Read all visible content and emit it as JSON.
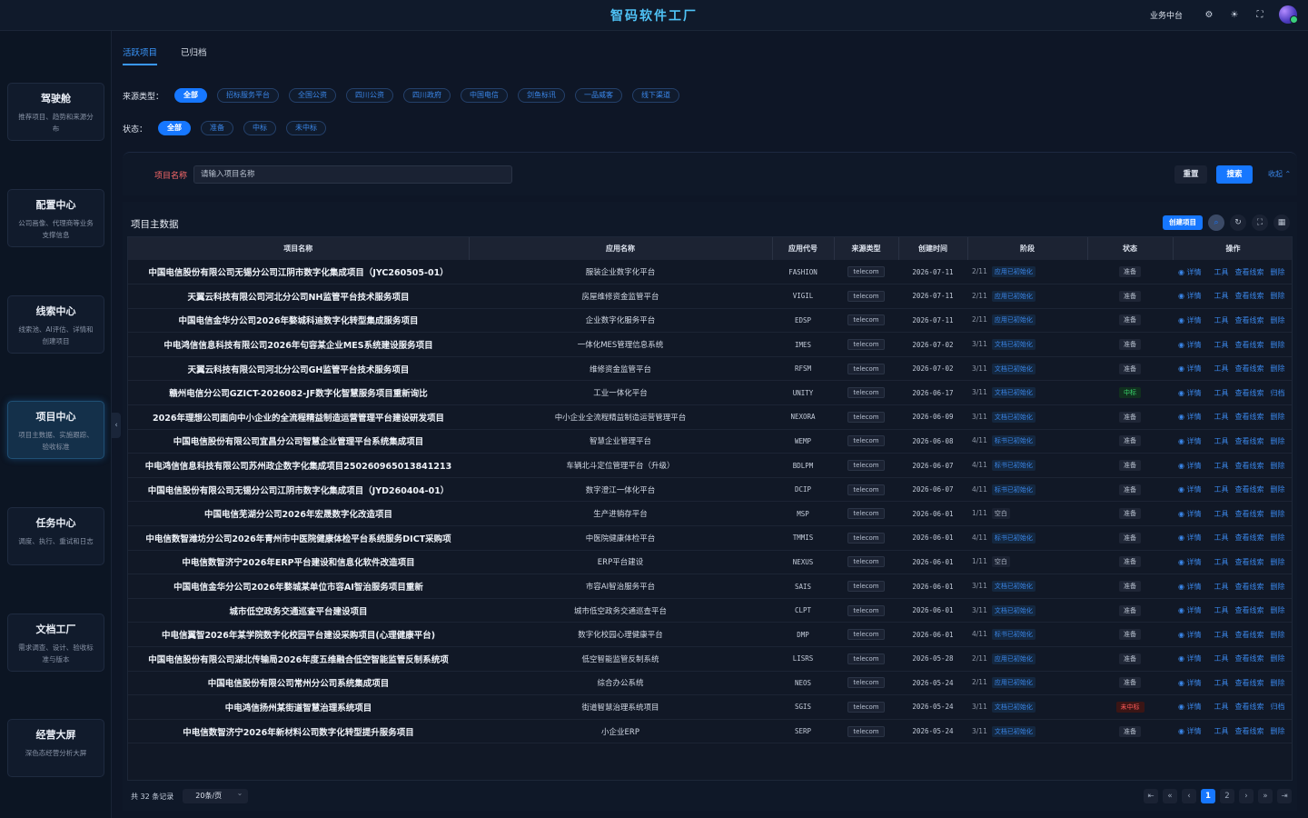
{
  "header": {
    "title": "智码软件工厂",
    "business_link": "业务中台",
    "icons": [
      "gear-icon",
      "sun-icon",
      "fullscreen-icon",
      "avatar"
    ]
  },
  "sidebar": {
    "items": [
      {
        "title": "驾驶舱",
        "desc": "推荐项目、趋势和来源分布"
      },
      {
        "title": "配置中心",
        "desc": "公司画像、代理商等业务支撑信息"
      },
      {
        "title": "线索中心",
        "desc": "线索池、AI评估、详情和创建项目"
      },
      {
        "title": "项目中心",
        "desc": "项目主数据、实施跟踪、验收标准"
      },
      {
        "title": "任务中心",
        "desc": "调度、执行、重试和日志"
      },
      {
        "title": "文档工厂",
        "desc": "需求调查、设计、验收标准与版本"
      },
      {
        "title": "经营大屏",
        "desc": "深色态经营分析大屏"
      }
    ],
    "active_index": 3
  },
  "tabs": [
    {
      "label": "活跃项目",
      "active": true
    },
    {
      "label": "已归档",
      "active": false
    }
  ],
  "filters": {
    "source_label": "来源类型：",
    "source_options": [
      "全部",
      "招标服务平台",
      "全国公资",
      "四川公资",
      "四川政府",
      "中国电信",
      "剑鱼标讯",
      "一品威客",
      "线下渠道"
    ],
    "status_label": "状态：",
    "status_options": [
      "全部",
      "准备",
      "中标",
      "未中标"
    ]
  },
  "search": {
    "label": "项目名称",
    "placeholder": "请输入项目名称",
    "reset": "重置",
    "submit": "搜索",
    "collapse": "收起 ⌃"
  },
  "table": {
    "title": "项目主数据",
    "create_button": "创建项目",
    "columns": [
      "项目名称",
      "应用名称",
      "应用代号",
      "来源类型",
      "创建时间",
      "阶段",
      "状态",
      "操作"
    ],
    "rows": [
      {
        "name": "中国电信股份有限公司无锡分公司江阴市数字化集成项目（JYC260505-01）",
        "app": "服装企业数字化平台",
        "code": "FASHION",
        "source": "telecom",
        "date": "2026-07-11",
        "step": "2/11",
        "stage": "应用已初始化",
        "status": "准备",
        "archive": "删除"
      },
      {
        "name": "天翼云科技有限公司河北分公司NH监管平台技术服务项目",
        "app": "房屋维修资金监管平台",
        "code": "VIGIL",
        "source": "telecom",
        "date": "2026-07-11",
        "step": "2/11",
        "stage": "应用已初始化",
        "status": "准备",
        "archive": "删除"
      },
      {
        "name": "中国电信金华分公司2026年婺城科迪数字化转型集成服务项目",
        "app": "企业数字化服务平台",
        "code": "EDSP",
        "source": "telecom",
        "date": "2026-07-11",
        "step": "2/11",
        "stage": "应用已初始化",
        "status": "准备",
        "archive": "删除"
      },
      {
        "name": "中电鸿信信息科技有限公司2026年句容某企业MES系统建设服务项目",
        "app": "一体化MES管理信息系统",
        "code": "IMES",
        "source": "telecom",
        "date": "2026-07-02",
        "step": "3/11",
        "stage": "文档已初始化",
        "status": "准备",
        "archive": "删除"
      },
      {
        "name": "天翼云科技有限公司河北分公司GH监管平台技术服务项目",
        "app": "维修资金监管平台",
        "code": "RFSM",
        "source": "telecom",
        "date": "2026-07-02",
        "step": "3/11",
        "stage": "文档已初始化",
        "status": "准备",
        "archive": "删除"
      },
      {
        "name": "赣州电信分公司GZICT-2026082-JF数字化智慧服务项目重新询比",
        "app": "工业一体化平台",
        "code": "UNITY",
        "source": "telecom",
        "date": "2026-06-17",
        "step": "3/11",
        "stage": "文档已初始化",
        "status": "中标",
        "archive": "归档"
      },
      {
        "name": "2026年理想公司面向中小企业的全流程精益制造运营管理平台建设研发项目",
        "app": "中小企业全流程精益制造运营管理平台",
        "code": "NEXORA",
        "source": "telecom",
        "date": "2026-06-09",
        "step": "3/11",
        "stage": "文档已初始化",
        "status": "准备",
        "archive": "删除"
      },
      {
        "name": "中国电信股份有限公司宜昌分公司智慧企业管理平台系统集成项目",
        "app": "智慧企业管理平台",
        "code": "WEMP",
        "source": "telecom",
        "date": "2026-06-08",
        "step": "4/11",
        "stage": "标书已初始化",
        "status": "准备",
        "archive": "删除"
      },
      {
        "name": "中电鸿信信息科技有限公司苏州政企数字化集成项目250260965013841213",
        "app": "车辆北斗定位管理平台（升级）",
        "code": "BDLPM",
        "source": "telecom",
        "date": "2026-06-07",
        "step": "4/11",
        "stage": "标书已初始化",
        "status": "准备",
        "archive": "删除"
      },
      {
        "name": "中国电信股份有限公司无锡分公司江阴市数字化集成项目（JYD260404-01）",
        "app": "数字澄江一体化平台",
        "code": "DCIP",
        "source": "telecom",
        "date": "2026-06-07",
        "step": "4/11",
        "stage": "标书已初始化",
        "status": "准备",
        "archive": "删除"
      },
      {
        "name": "中国电信芜湖分公司2026年宏晟数字化改造项目",
        "app": "生产进销存平台",
        "code": "MSP",
        "source": "telecom",
        "date": "2026-06-01",
        "step": "1/11",
        "stage": "空白",
        "status": "准备",
        "archive": "删除"
      },
      {
        "name": "中电信数智潍坊分公司2026年青州市中医院健康体检平台系统服务DICT采购项",
        "app": "中医院健康体检平台",
        "code": "TMMIS",
        "source": "telecom",
        "date": "2026-06-01",
        "step": "4/11",
        "stage": "标书已初始化",
        "status": "准备",
        "archive": "删除"
      },
      {
        "name": "中电信数智济宁2026年ERP平台建设和信息化软件改造项目",
        "app": "ERP平台建设",
        "code": "NEXUS",
        "source": "telecom",
        "date": "2026-06-01",
        "step": "1/11",
        "stage": "空白",
        "status": "准备",
        "archive": "删除"
      },
      {
        "name": "中国电信金华分公司2026年婺城某单位市容AI智治服务项目重新",
        "app": "市容AI智治服务平台",
        "code": "SAIS",
        "source": "telecom",
        "date": "2026-06-01",
        "step": "3/11",
        "stage": "文档已初始化",
        "status": "准备",
        "archive": "删除"
      },
      {
        "name": "城市低空政务交通巡查平台建设项目",
        "app": "城市低空政务交通巡查平台",
        "code": "CLPT",
        "source": "telecom",
        "date": "2026-06-01",
        "step": "3/11",
        "stage": "文档已初始化",
        "status": "准备",
        "archive": "删除"
      },
      {
        "name": "中电信翼智2026年某学院数字化校园平台建设采购项目(心理健康平台)",
        "app": "数字化校园心理健康平台",
        "code": "DMP",
        "source": "telecom",
        "date": "2026-06-01",
        "step": "4/11",
        "stage": "标书已初始化",
        "status": "准备",
        "archive": "删除"
      },
      {
        "name": "中国电信股份有限公司湖北传输局2026年度五维融合低空智能监管反制系统项",
        "app": "低空智能监管反制系统",
        "code": "LISRS",
        "source": "telecom",
        "date": "2026-05-28",
        "step": "2/11",
        "stage": "应用已初始化",
        "status": "准备",
        "archive": "删除"
      },
      {
        "name": "中国电信股份有限公司常州分公司系统集成项目",
        "app": "综合办公系统",
        "code": "NEOS",
        "source": "telecom",
        "date": "2026-05-24",
        "step": "2/11",
        "stage": "应用已初始化",
        "status": "准备",
        "archive": "删除"
      },
      {
        "name": "中电鸿信扬州某街道智慧治理系统项目",
        "app": "街道智慧治理系统项目",
        "code": "SGIS",
        "source": "telecom",
        "date": "2026-05-24",
        "step": "3/11",
        "stage": "文档已初始化",
        "status": "未中标",
        "archive": "归档"
      },
      {
        "name": "中电信数智济宁2026年新材料公司数字化转型提升服务项目",
        "app": "小企业ERP",
        "code": "SERP",
        "source": "telecom",
        "date": "2026-05-24",
        "step": "3/11",
        "stage": "文档已初始化",
        "status": "准备",
        "archive": "删除"
      }
    ],
    "row_actions": [
      "详情",
      "工具",
      "查看线索"
    ]
  },
  "pagination": {
    "total": "共 32 条记录",
    "page_size": "20条/页",
    "pages": [
      "1",
      "2"
    ],
    "current": "1"
  },
  "colors": {
    "accent": "#1677ff",
    "title": "#4fc3f7",
    "won": "#39d36b",
    "lost": "#ff5a5a"
  }
}
